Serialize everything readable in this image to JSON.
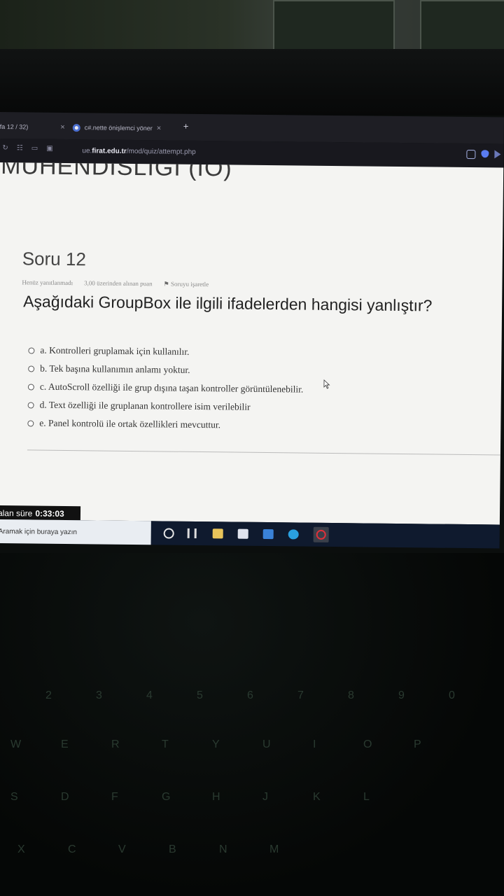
{
  "browser": {
    "tab1_label": "fa 12 / 32)",
    "tab1_close": "×",
    "tab2_label": "c#.nette önişlemci yöner",
    "tab2_close": "×",
    "newtab": "+",
    "url_prefix": "ue.",
    "url_domain": "firat.edu.tr",
    "url_path": "/mod/quiz/attempt.php"
  },
  "page": {
    "course_title": "MÜHENDİSLİĞİ (İÖ)",
    "question_number": "Soru 12",
    "status": "Henüz yanıtlanmadı",
    "points": "3,00 üzerinden alınan puan",
    "flag_label": "Soruyu işaretle",
    "question_text": "Aşağıdaki GroupBox ile ilgili ifadelerden hangisi yanlıştır?",
    "options": [
      "a. Kontrolleri gruplamak için kullanılır.",
      "b. Tek başına kullanımın anlamı yoktur.",
      "c. AutoScroll özelliği ile grup dışına taşan kontroller görüntülenebilir.",
      "d. Text özelliği ile gruplanan kontrollere isim verilebilir",
      "e. Panel kontrolü ile ortak özellikleri mevcuttur."
    ],
    "timer_label": "alan süre",
    "timer_value": "0:33:03"
  },
  "taskbar": {
    "search_placeholder": "Aramak için buraya yazın"
  },
  "keyboard": {
    "keys": [
      "2",
      "3",
      "4",
      "5",
      "6",
      "7",
      "8",
      "9",
      "0",
      "W",
      "E",
      "R",
      "T",
      "Y",
      "U",
      "I",
      "O",
      "P",
      "S",
      "D",
      "F",
      "G",
      "H",
      "J",
      "K",
      "L",
      "X",
      "C",
      "V",
      "B",
      "N",
      "M"
    ]
  },
  "colors": {
    "page_bg": "#f4f4f2",
    "taskbar": "#0f1a2e",
    "tabbar": "#1e1e24"
  }
}
